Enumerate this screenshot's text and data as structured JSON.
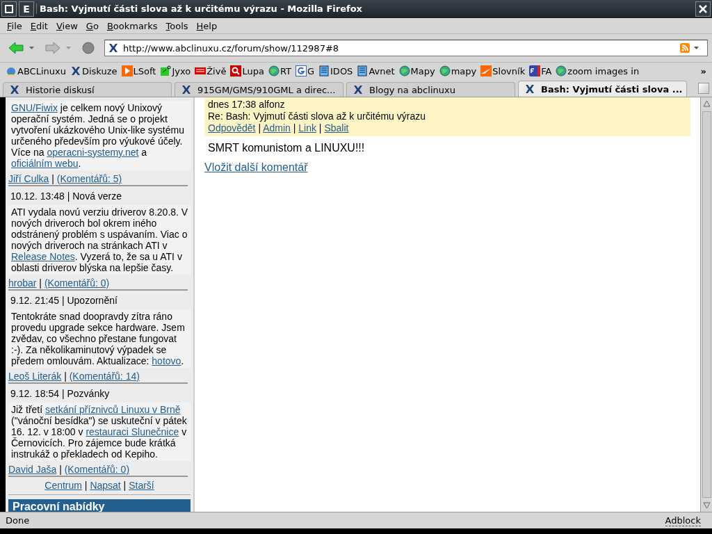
{
  "window": {
    "title": "Bash: Vyjmutí části slova až k určitému výrazu - Mozilla Firefox",
    "menu_button": "E"
  },
  "menu": [
    "File",
    "Edit",
    "View",
    "Go",
    "Bookmarks",
    "Tools",
    "Help"
  ],
  "address": {
    "value": "http://www.abclinuxu.cz/forum/show/112987#8"
  },
  "bookmarks": [
    {
      "label": "ABCLinuxu",
      "kind": "abc"
    },
    {
      "label": "Diskuze",
      "kind": "site"
    },
    {
      "label": "LSoft",
      "kind": "play"
    },
    {
      "label": "Jyxo",
      "kind": "green"
    },
    {
      "label": "Živě",
      "kind": "zive"
    },
    {
      "label": "Lupa",
      "kind": "lupa"
    },
    {
      "label": "RT",
      "kind": "globe"
    },
    {
      "label": "G",
      "kind": "google"
    },
    {
      "label": "IDOS",
      "kind": "doc"
    },
    {
      "label": "Avnet",
      "kind": "doc"
    },
    {
      "label": "Mapy",
      "kind": "globe"
    },
    {
      "label": "mapy",
      "kind": "globe"
    },
    {
      "label": "Slovník",
      "kind": "slovnik"
    },
    {
      "label": "FA",
      "kind": "fa"
    },
    {
      "label": "zoom images in",
      "kind": "globe"
    }
  ],
  "bookmarks_more": "»",
  "tabs": [
    {
      "label": "Historie diskusí",
      "selected": false
    },
    {
      "label": "915GM/GMS/910GML a direc...",
      "selected": false
    },
    {
      "label": "Blogy na abclinuxu",
      "selected": false
    },
    {
      "label": "Bash: Vyjmutí části slova ...",
      "selected": true
    }
  ],
  "sidebar": {
    "news": [
      {
        "body": [
          {
            "link": "GNU/Fiwix"
          },
          {
            "text": " je celkem nový Unixový operační systém. Jedná se o projekt vytvoření ukázkového Unix-like systému určeného především pro výukové účely. Více na "
          },
          {
            "link": "operacni-systemy.net"
          },
          {
            "text": " a "
          },
          {
            "link": "oficiálním webu"
          },
          {
            "text": "."
          }
        ],
        "footer": [
          {
            "link": "Jiří Culka"
          },
          {
            "text": " | "
          },
          {
            "link": "(Komentářů: 5)"
          }
        ]
      },
      {
        "meta": "10.12. 13:48 | Nová verze",
        "body": [
          {
            "text": "ATI vydala novú verziu driverov 8.20.8. V nových driveroch bol okrem iného odstránený problém s uspávaním. Viac o nových driveroch na stránkach ATI v "
          },
          {
            "link": "Release Notes"
          },
          {
            "text": ". Vyzerá to, že sa u ATI v oblasti driverov blýska na lepšie časy."
          }
        ],
        "footer": [
          {
            "link": "hrobar"
          },
          {
            "text": " | "
          },
          {
            "link": "(Komentářů: 0)"
          }
        ]
      },
      {
        "meta": "9.12. 21:45 | Upozornění",
        "body": [
          {
            "text": "Tentokráte snad doopravdy zítra ráno provedu upgrade sekce hardware. Jsem zvědav, co všechno přestane fungovat :-). Za několikaminutový výpadek se předem omlouvám. Aktualizace: "
          },
          {
            "link": "hotovo"
          },
          {
            "text": "."
          }
        ],
        "footer": [
          {
            "link": "Leoš Literák"
          },
          {
            "text": " | "
          },
          {
            "link": "(Komentářů: 14)"
          }
        ]
      },
      {
        "meta": "9.12. 18:54 | Pozvánky",
        "body": [
          {
            "text": "Již třetí "
          },
          {
            "link": "setkání příznivců Linuxu v Brně"
          },
          {
            "text": " (\"vánoční besídka\") se uskuteční v pátek 16. 12. v 18:00 v "
          },
          {
            "link": "restauraci Slunečnice"
          },
          {
            "text": " v Černovicích. Pro zájemce bude krátká instrukáž o překladech od Kepiho."
          }
        ],
        "footer": [
          {
            "link": "David Jaša"
          },
          {
            "text": " | "
          },
          {
            "link": "(Komentářů: 0)"
          }
        ]
      }
    ],
    "nav": [
      {
        "link": "Centrum"
      },
      {
        "text": " | "
      },
      {
        "link": "Napsat"
      },
      {
        "text": " | "
      },
      {
        "link": "Starší"
      }
    ],
    "section_title": "Pracovní nabídky"
  },
  "comment": {
    "meta": "dnes 17:38 alfonz",
    "subject": "Re: Bash: Vyjmutí části slova až k určitému výrazu",
    "actions": [
      {
        "link": "Odpovědět"
      },
      {
        "text": " | "
      },
      {
        "link": "Admin"
      },
      {
        "text": " | "
      },
      {
        "link": "Link"
      },
      {
        "text": " | "
      },
      {
        "link": "Sbalit"
      }
    ],
    "body": "SMRT komunistom a LINUXU!!!"
  },
  "add_comment": "Vložit další komentář",
  "status_bar": {
    "text": "Done",
    "adblock": "Adblock"
  }
}
